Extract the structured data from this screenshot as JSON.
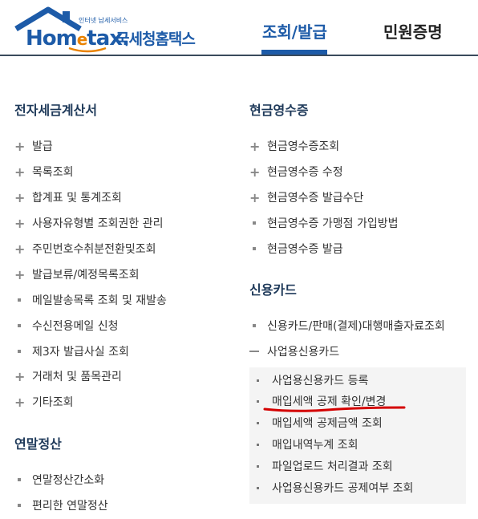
{
  "header": {
    "logo_tagline": "인터넷 납세서비스",
    "logo_home": "Hom",
    "logo_e": "e",
    "logo_tax": "tax.",
    "logo_korean": "국세청홈택스",
    "tabs": [
      {
        "label": "조회/발급",
        "active": true
      },
      {
        "label": "민원증명",
        "active": false
      }
    ]
  },
  "left": {
    "section1_title": "전자세금계산서",
    "section1_items": [
      {
        "label": "발급",
        "marker": "plus"
      },
      {
        "label": "목록조회",
        "marker": "plus"
      },
      {
        "label": "합계표 및 통계조회",
        "marker": "plus"
      },
      {
        "label": "사용자유형별 조회권한 관리",
        "marker": "plus"
      },
      {
        "label": "주민번호수취분전환및조회",
        "marker": "plus"
      },
      {
        "label": "발급보류/예정목록조회",
        "marker": "plus"
      },
      {
        "label": "메일발송목록 조회 및 재발송",
        "marker": "square"
      },
      {
        "label": "수신전용메일 신청",
        "marker": "square"
      },
      {
        "label": "제3자 발급사실 조회",
        "marker": "square"
      },
      {
        "label": "거래처 및 품목관리",
        "marker": "plus"
      },
      {
        "label": "기타조회",
        "marker": "plus"
      }
    ],
    "section2_title": "연말정산",
    "section2_items": [
      {
        "label": "연말정산간소화",
        "marker": "square"
      },
      {
        "label": "편리한 연말정산",
        "marker": "square"
      }
    ]
  },
  "right": {
    "section1_title": "현금영수증",
    "section1_items": [
      {
        "label": "현금영수증조회",
        "marker": "plus"
      },
      {
        "label": "현금영수증 수정",
        "marker": "plus"
      },
      {
        "label": "현금영수증 발급수단",
        "marker": "plus"
      },
      {
        "label": "현금영수증 가맹점 가입방법",
        "marker": "square"
      },
      {
        "label": "현금영수증 발급",
        "marker": "square"
      }
    ],
    "section2_title": "신용카드",
    "section2_items": [
      {
        "label": "신용카드/판매(결제)대행매출자료조회",
        "marker": "square"
      },
      {
        "label": "사업용신용카드",
        "marker": "minus"
      }
    ],
    "sub_items": [
      {
        "label": "사업용신용카드 등록"
      },
      {
        "label": "매입세액 공제 확인/변경",
        "highlighted": true
      },
      {
        "label": "매입세액 공제금액 조회"
      },
      {
        "label": "매입내역누계 조회"
      },
      {
        "label": "파일업로드 처리결과 조회"
      },
      {
        "label": "사업용신용카드 공제여부 조회"
      }
    ]
  },
  "colors": {
    "brand": "#1d5ba8",
    "accent": "#e98200",
    "annotation": "#d40000"
  }
}
